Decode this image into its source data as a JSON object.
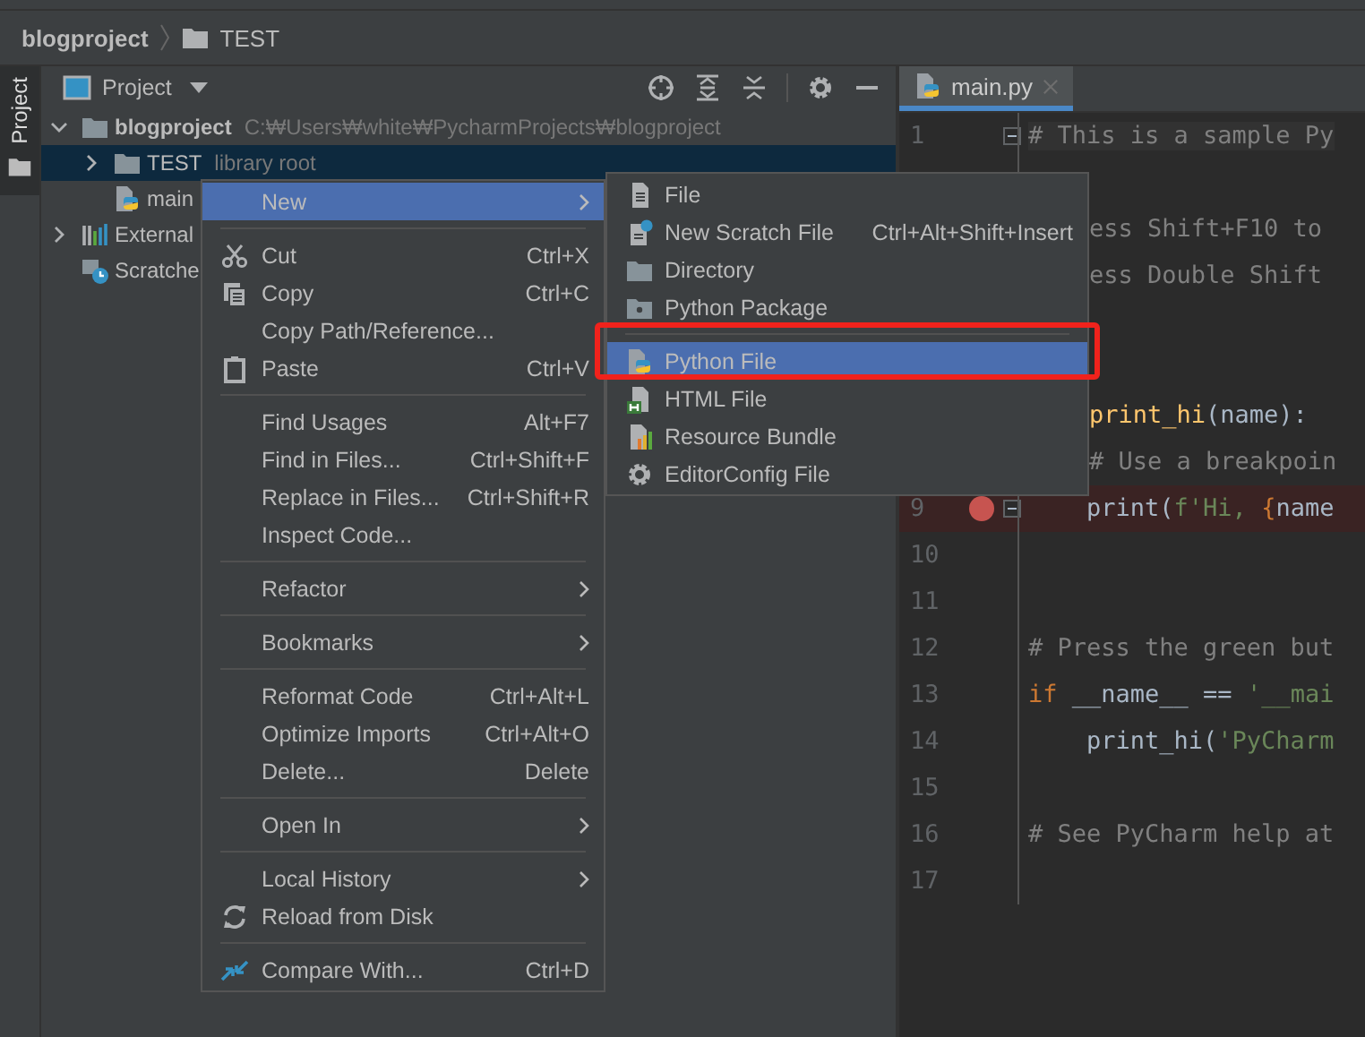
{
  "breadcrumb": {
    "project": "blogproject",
    "folder": "TEST"
  },
  "tool_stripe": {
    "label": "Project",
    "selected": true
  },
  "project_panel": {
    "title": "Project",
    "tree": [
      {
        "label": "blogproject",
        "path": "C:₩Users₩white₩PycharmProjects₩blogproject",
        "expanded": true,
        "selected": false,
        "children": [
          {
            "label": "TEST",
            "note": "library root",
            "expanded": false,
            "selected": true
          },
          {
            "label": "main",
            "selected": false
          }
        ]
      },
      {
        "label": "External",
        "expanded": false,
        "selected": false
      },
      {
        "label": "Scratche",
        "selected": false
      }
    ]
  },
  "editor": {
    "tab": {
      "label": "main.py",
      "selected": true
    },
    "lines": [
      {
        "kind": "line",
        "number": "1",
        "current": true,
        "fold": true,
        "segments": [
          {
            "kind": "comment",
            "text": "# This is a sample Py"
          }
        ]
      },
      {
        "kind": "hidden"
      },
      {
        "kind": "partial",
        "segments": [
          {
            "kind": "comment",
            "text": "ess Shift+F10 to"
          }
        ]
      },
      {
        "kind": "partial",
        "segments": [
          {
            "kind": "comment",
            "text": "ess Double Shift"
          }
        ]
      },
      {
        "kind": "hidden"
      },
      {
        "kind": "hidden"
      },
      {
        "kind": "partial",
        "segments": [
          {
            "kind": "function",
            "text": "print_hi"
          },
          {
            "kind": "plain",
            "text": "(name):"
          }
        ]
      },
      {
        "kind": "partial",
        "segments": [
          {
            "kind": "comment",
            "text": "# Use a breakpoin"
          }
        ]
      },
      {
        "kind": "line",
        "number": "9",
        "breakpoint": true,
        "fold": true,
        "segments": [
          {
            "kind": "plain",
            "text": "    print("
          },
          {
            "kind": "string",
            "text": "f'Hi, "
          },
          {
            "kind": "keyword",
            "text": "{"
          },
          {
            "kind": "plain",
            "text": "name"
          }
        ]
      },
      {
        "kind": "line",
        "number": "10"
      },
      {
        "kind": "line",
        "number": "11"
      },
      {
        "kind": "line",
        "number": "12",
        "segments": [
          {
            "kind": "comment",
            "text": "# Press the green but"
          }
        ]
      },
      {
        "kind": "line",
        "number": "13",
        "segments": [
          {
            "kind": "keyword",
            "text": "if"
          },
          {
            "kind": "plain",
            "text": " __name__ == "
          },
          {
            "kind": "string",
            "text": "'__mai"
          }
        ]
      },
      {
        "kind": "line",
        "number": "14",
        "segments": [
          {
            "kind": "plain",
            "text": "    print_hi("
          },
          {
            "kind": "string",
            "text": "'PyCharm"
          }
        ]
      },
      {
        "kind": "line",
        "number": "15"
      },
      {
        "kind": "line",
        "number": "16",
        "segments": [
          {
            "kind": "comment",
            "text": "# See PyCharm help at"
          }
        ]
      },
      {
        "kind": "line",
        "number": "17"
      }
    ]
  },
  "context_menu": [
    {
      "kind": "item",
      "label": "New",
      "submenu": true,
      "selected": true
    },
    {
      "kind": "separator"
    },
    {
      "kind": "item",
      "label": "Cut",
      "shortcut": "Ctrl+X",
      "selected": false
    },
    {
      "kind": "item",
      "label": "Copy",
      "shortcut": "Ctrl+C",
      "selected": false
    },
    {
      "kind": "item",
      "label": "Copy Path/Reference...",
      "selected": false
    },
    {
      "kind": "item",
      "label": "Paste",
      "shortcut": "Ctrl+V",
      "selected": false
    },
    {
      "kind": "separator"
    },
    {
      "kind": "item",
      "label": "Find Usages",
      "shortcut": "Alt+F7",
      "selected": false
    },
    {
      "kind": "item",
      "label": "Find in Files...",
      "shortcut": "Ctrl+Shift+F",
      "selected": false
    },
    {
      "kind": "item",
      "label": "Replace in Files...",
      "shortcut": "Ctrl+Shift+R",
      "selected": false
    },
    {
      "kind": "item",
      "label": "Inspect Code...",
      "selected": false
    },
    {
      "kind": "separator"
    },
    {
      "kind": "item",
      "label": "Refactor",
      "submenu": true,
      "selected": false
    },
    {
      "kind": "separator"
    },
    {
      "kind": "item",
      "label": "Bookmarks",
      "submenu": true,
      "selected": false
    },
    {
      "kind": "separator"
    },
    {
      "kind": "item",
      "label": "Reformat Code",
      "shortcut": "Ctrl+Alt+L",
      "selected": false
    },
    {
      "kind": "item",
      "label": "Optimize Imports",
      "shortcut": "Ctrl+Alt+O",
      "selected": false
    },
    {
      "kind": "item",
      "label": "Delete...",
      "shortcut": "Delete",
      "selected": false
    },
    {
      "kind": "separator"
    },
    {
      "kind": "item",
      "label": "Open In",
      "submenu": true,
      "selected": false
    },
    {
      "kind": "separator"
    },
    {
      "kind": "item",
      "label": "Local History",
      "submenu": true,
      "selected": false
    },
    {
      "kind": "item",
      "label": "Reload from Disk",
      "selected": false
    },
    {
      "kind": "separator"
    },
    {
      "kind": "item",
      "label": "Compare With...",
      "shortcut": "Ctrl+D",
      "selected": false
    }
  ],
  "new_submenu": [
    {
      "kind": "item",
      "label": "File",
      "selected": false
    },
    {
      "kind": "item",
      "label": "New Scratch File",
      "shortcut": "Ctrl+Alt+Shift+Insert",
      "selected": false
    },
    {
      "kind": "item",
      "label": "Directory",
      "selected": false
    },
    {
      "kind": "item",
      "label": "Python Package",
      "selected": false
    },
    {
      "kind": "separator"
    },
    {
      "kind": "item",
      "label": "Python File",
      "selected": true,
      "framed": true
    },
    {
      "kind": "item",
      "label": "HTML File",
      "selected": false
    },
    {
      "kind": "item",
      "label": "Resource Bundle",
      "selected": false
    },
    {
      "kind": "item",
      "label": "EditorConfig File",
      "selected": false
    }
  ]
}
